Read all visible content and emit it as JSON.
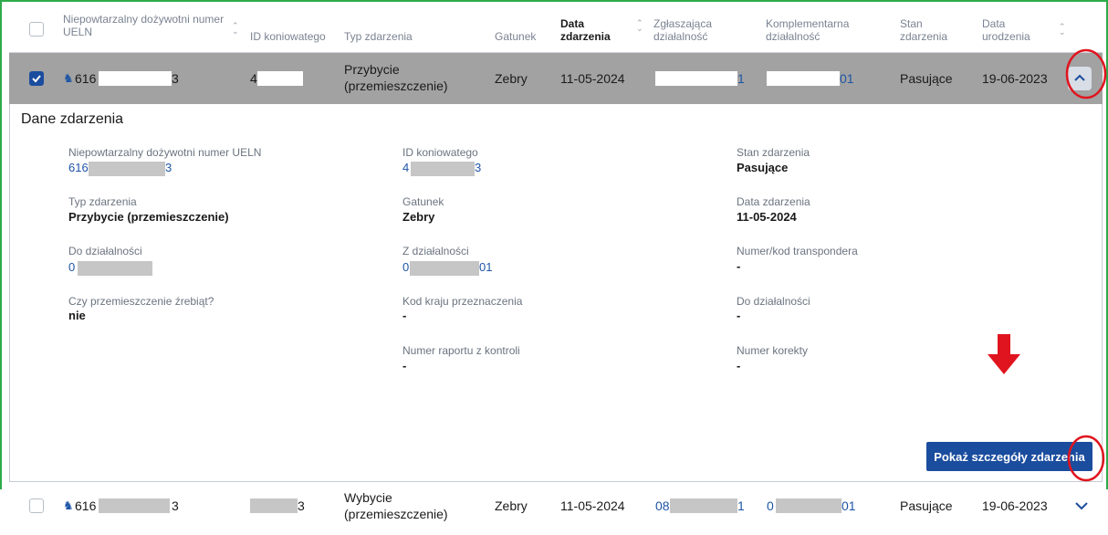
{
  "header": {
    "ueln": "Niepowtarzalny dożywotni numer UELN",
    "horse_id": "ID koniowatego",
    "event_type": "Typ zdarzenia",
    "species": "Gatunek",
    "event_date": "Data zdarzenia",
    "reporting_activity": "Zgłaszająca działalność",
    "complementary_activity": "Komplementarna działalność",
    "status": "Stan zdarzenia",
    "birth_date": "Data urodzenia"
  },
  "rows": [
    {
      "ueln_start": "616",
      "ueln_end": "3",
      "horse_id_start": "4",
      "event_type": "Przybycie (przemieszczenie)",
      "species": "Zebry",
      "event_date": "11-05-2024",
      "reporting_end": "1",
      "complementary_end": "01",
      "status": "Pasujące",
      "birth_date": "19-06-2023",
      "checked": true
    },
    {
      "ueln_start": "616",
      "ueln_end": "3",
      "horse_id_end": "3",
      "event_type": "Wybycie (przemieszczenie)",
      "species": "Zebry",
      "event_date": "11-05-2024",
      "reporting_start": "08",
      "reporting_end": "1",
      "complementary_start": "0",
      "complementary_end": "01",
      "status": "Pasujące",
      "birth_date": "19-06-2023",
      "checked": false
    }
  ],
  "details": {
    "title": "Dane zdarzenia",
    "ueln_label": "Niepowtarzalny dożywotni numer UELN",
    "ueln_start": "616",
    "ueln_end": "3",
    "horse_id_label": "ID koniowatego",
    "horse_id_start": "4",
    "horse_id_end": "3",
    "status_label": "Stan zdarzenia",
    "status_value": "Pasujące",
    "event_type_label": "Typ zdarzenia",
    "event_type_value": "Przybycie (przemieszczenie)",
    "species_label": "Gatunek",
    "species_value": "Zebry",
    "event_date_label": "Data zdarzenia",
    "event_date_value": "11-05-2024",
    "to_activity_label": "Do działalności",
    "to_activity_start": "0",
    "from_activity_label": "Z działalności",
    "from_activity_start": "0",
    "from_activity_end": "01",
    "transponder_label": "Numer/kod transpondera",
    "transponder_value": "-",
    "foals_label": "Czy przemieszczenie źrebiąt?",
    "foals_value": "nie",
    "destination_country_label": "Kod kraju przeznaczenia",
    "destination_country_value": "-",
    "to_activity2_label": "Do działalności",
    "to_activity2_value": "-",
    "inspection_report_label": "Numer raportu z kontroli",
    "inspection_report_value": "-",
    "correction_label": "Numer korekty",
    "correction_value": "-",
    "show_details_button": "Pokaż szczegóły zdarzenia"
  },
  "icons": {
    "sort": "sort-icon",
    "horse": "horse-icon",
    "chevron_up": "chevron-up-icon",
    "chevron_down": "chevron-down-icon",
    "arrow": "arrow-down-icon"
  },
  "colors": {
    "primary": "#1b4d9e",
    "link": "#1e55a5",
    "selected_row": "#a2a2a2",
    "annotation_red": "#e0141e",
    "frame_green": "#2eaa4a"
  }
}
